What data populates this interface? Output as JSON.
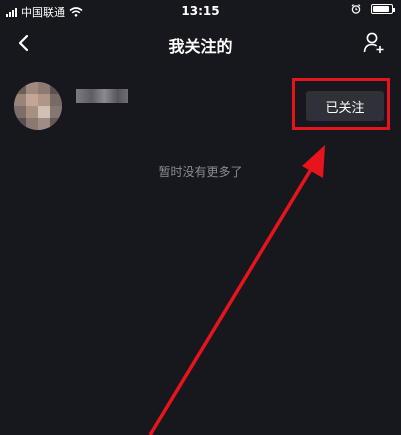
{
  "status_bar": {
    "carrier": "中国联通",
    "time": "13:15",
    "battery_level": 0.9
  },
  "nav": {
    "title": "我关注的",
    "back_icon": "chevron-left-icon",
    "add_user_icon": "add-user-icon"
  },
  "following": [
    {
      "avatar": "avatar-blurred",
      "name_hidden": true,
      "follow_label": "已关注"
    }
  ],
  "footer": {
    "no_more": "暂时没有更多了"
  },
  "annotation": {
    "highlight_color": "#e8141b",
    "arrow_color": "#e8141b"
  },
  "colors": {
    "background": "#17181e",
    "button_bg": "#2f3038",
    "muted_text": "#8a8b92"
  }
}
